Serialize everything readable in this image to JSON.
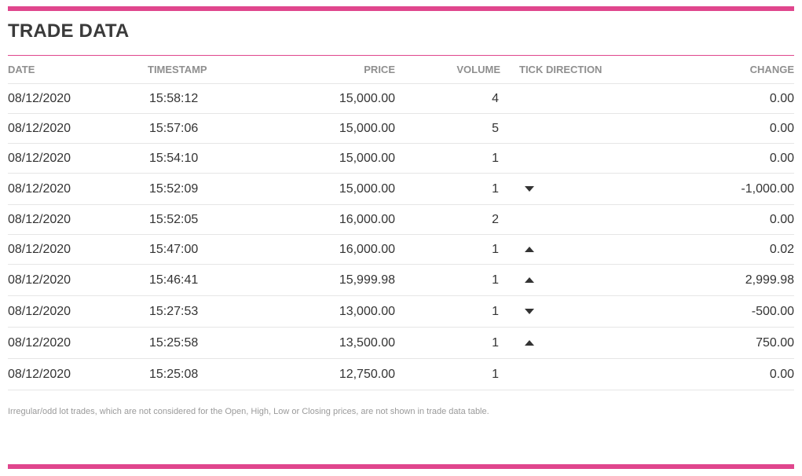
{
  "title": "TRADE DATA",
  "accent_color": "#e0468d",
  "columns": {
    "date": "DATE",
    "timestamp": "TIMESTAMP",
    "price": "PRICE",
    "volume": "VOLUME",
    "tick_direction": "TICK DIRECTION",
    "change": "CHANGE"
  },
  "rows": [
    {
      "date": "08/12/2020",
      "timestamp": "15:58:12",
      "price": "15,000.00",
      "volume": "4",
      "tick": "",
      "change": "0.00"
    },
    {
      "date": "08/12/2020",
      "timestamp": "15:57:06",
      "price": "15,000.00",
      "volume": "5",
      "tick": "",
      "change": "0.00"
    },
    {
      "date": "08/12/2020",
      "timestamp": "15:54:10",
      "price": "15,000.00",
      "volume": "1",
      "tick": "",
      "change": "0.00"
    },
    {
      "date": "08/12/2020",
      "timestamp": "15:52:09",
      "price": "15,000.00",
      "volume": "1",
      "tick": "down",
      "change": "-1,000.00"
    },
    {
      "date": "08/12/2020",
      "timestamp": "15:52:05",
      "price": "16,000.00",
      "volume": "2",
      "tick": "",
      "change": "0.00"
    },
    {
      "date": "08/12/2020",
      "timestamp": "15:47:00",
      "price": "16,000.00",
      "volume": "1",
      "tick": "up",
      "change": "0.02"
    },
    {
      "date": "08/12/2020",
      "timestamp": "15:46:41",
      "price": "15,999.98",
      "volume": "1",
      "tick": "up",
      "change": "2,999.98"
    },
    {
      "date": "08/12/2020",
      "timestamp": "15:27:53",
      "price": "13,000.00",
      "volume": "1",
      "tick": "down",
      "change": "-500.00"
    },
    {
      "date": "08/12/2020",
      "timestamp": "15:25:58",
      "price": "13,500.00",
      "volume": "1",
      "tick": "up",
      "change": "750.00"
    },
    {
      "date": "08/12/2020",
      "timestamp": "15:25:08",
      "price": "12,750.00",
      "volume": "1",
      "tick": "",
      "change": "0.00"
    }
  ],
  "note": "Irregular/odd lot trades, which are not considered for the Open, High, Low or Closing prices, are not shown in trade data table."
}
